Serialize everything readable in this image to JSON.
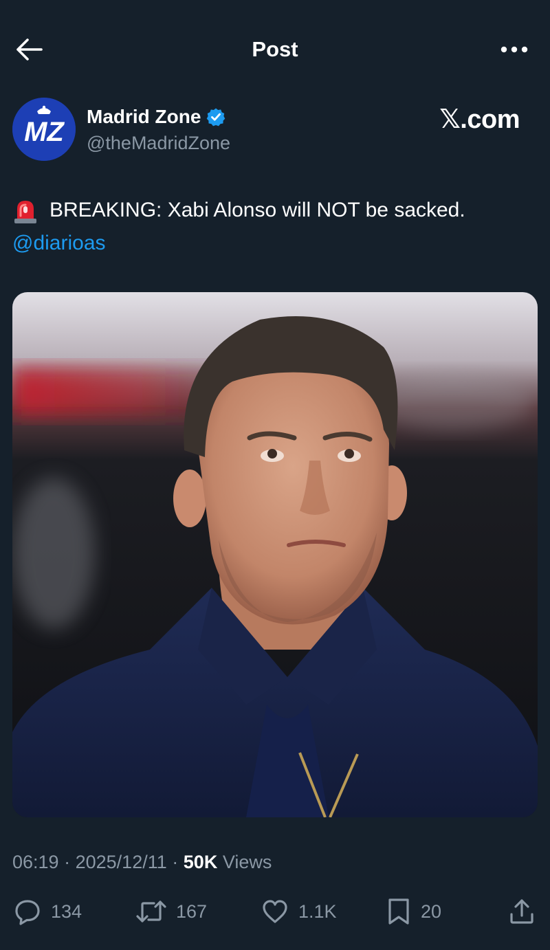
{
  "header": {
    "title": "Post",
    "back_icon": "arrow-left-icon",
    "more_icon": "more-horizontal-icon"
  },
  "author": {
    "display_name": "Madrid Zone",
    "handle": "@theMadridZone",
    "verified": true,
    "avatar_text": "MZ",
    "avatar_color": "#1d3fb5",
    "verified_color": "#1d9bf0"
  },
  "watermark": "𝕏.com",
  "tweet": {
    "emoji_icon": "police-siren-icon",
    "text": "BREAKING: Xabi Alonso will NOT be sacked.",
    "mention": "@diarioas"
  },
  "media": {
    "type": "photo"
  },
  "meta": {
    "time": "06:19",
    "separator": "·",
    "date": "2025/12/11",
    "views_count": "50K",
    "views_label": "Views"
  },
  "actions": {
    "replies": "134",
    "reposts": "167",
    "likes": "1.1K",
    "bookmarks": "20"
  },
  "colors": {
    "background": "#15202b",
    "text": "#ffffff",
    "secondary": "#8b98a5",
    "link": "#1d9bf0"
  }
}
